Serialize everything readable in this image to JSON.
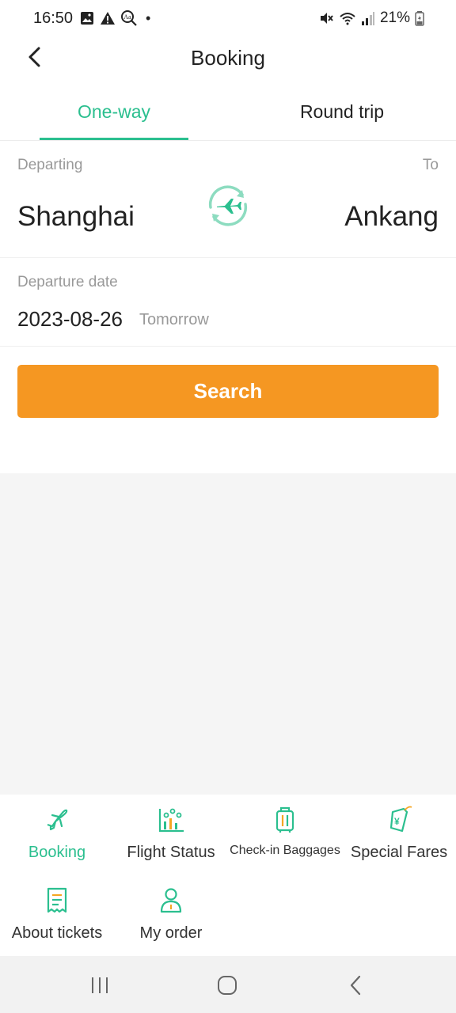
{
  "status_bar": {
    "time": "16:50",
    "dot": "•",
    "battery_text": "21%",
    "icons_left": [
      "gallery-icon",
      "warning-icon",
      "font-icon"
    ],
    "icons_right": [
      "mute-icon",
      "wifi-icon",
      "signal-icon",
      "battery-icon"
    ]
  },
  "header": {
    "title": "Booking",
    "back_icon": "chevron-left-icon"
  },
  "tabs": [
    {
      "label": "One-way",
      "active": true
    },
    {
      "label": "Round trip",
      "active": false
    }
  ],
  "route": {
    "departing_label": "Departing",
    "to_label": "To",
    "from_city": "Shanghai",
    "to_city": "Ankang",
    "swap_icon": "plane-swap-icon"
  },
  "date": {
    "label": "Departure date",
    "value": "2023-08-26",
    "hint": "Tomorrow"
  },
  "search": {
    "label": "Search"
  },
  "menu": [
    {
      "label": "Booking",
      "icon": "plane-icon",
      "active": true
    },
    {
      "label": "Flight Status",
      "icon": "flight-status-icon",
      "active": false
    },
    {
      "label": "Check-in Baggages",
      "icon": "luggage-icon",
      "active": false
    },
    {
      "label": "Special Fares",
      "icon": "price-tag-icon",
      "active": false
    },
    {
      "label": "About tickets",
      "icon": "receipt-icon",
      "active": false
    },
    {
      "label": "My order",
      "icon": "user-order-icon",
      "active": false
    }
  ],
  "colors": {
    "accent": "#2bbf8f",
    "search_button": "#f59722",
    "label_gray": "#999999"
  }
}
